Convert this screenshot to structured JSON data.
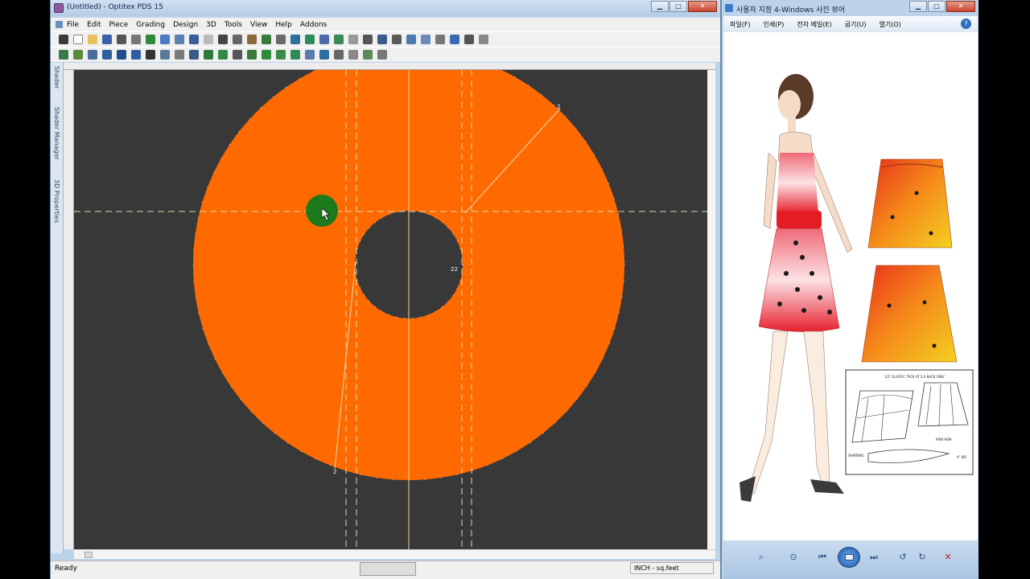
{
  "pds_window": {
    "title": "(Untitled) - Optitex PDS 15",
    "menu": [
      "File",
      "Edit",
      "Piece",
      "Grading",
      "Design",
      "3D",
      "Tools",
      "View",
      "Help",
      "Addons"
    ],
    "side_tabs": [
      "Shader",
      "Shader Manager",
      "3D Properties"
    ],
    "status": {
      "ready": "Ready",
      "units": "INCH - sq.feet"
    },
    "piece_labels": {
      "outer_top": "2",
      "inner_notch": "22",
      "bottom_left": "2"
    },
    "colors": {
      "piece_fill": "#ff6a00",
      "canvas": "#383838",
      "cursor_marker": "#1c7a1c"
    }
  },
  "photo_window": {
    "title": "사용자 지정 4-Windows 사진 뷰어",
    "menu": [
      "파일(F)",
      "인쇄(P)",
      "전자 메일(E)",
      "굽기(U)",
      "열기(O)"
    ],
    "help_icon": "?",
    "tech_sheet_note": "1/2\" ELASTIC TACK AT S.S BACK ONLY",
    "tech_sheet_labels": {
      "raw_hem": "RAW HEM",
      "shirring": "SHIRRING",
      "measure": "4\" WS"
    }
  }
}
